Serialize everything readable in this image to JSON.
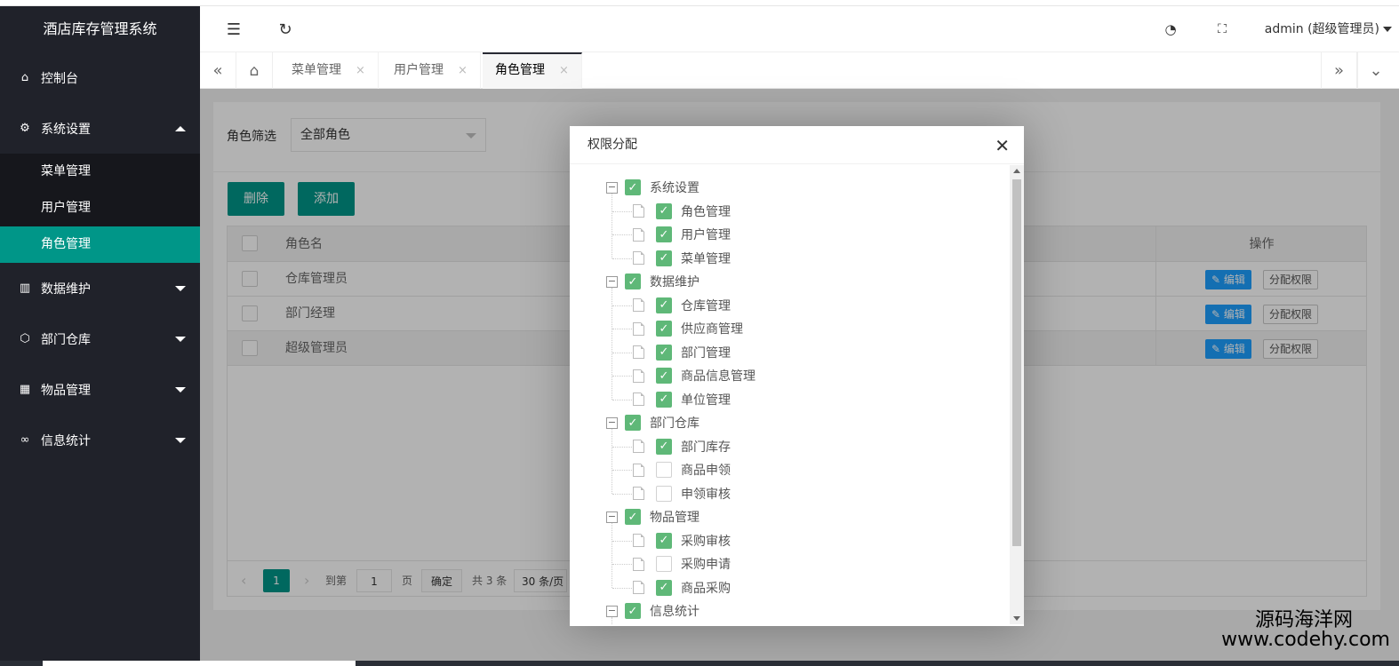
{
  "app": {
    "title": "酒店库存管理系统"
  },
  "sidebar": {
    "items": [
      {
        "label": "控制台",
        "icon": "home-icon"
      },
      {
        "label": "系统设置",
        "icon": "gear-icon",
        "expanded": true,
        "children": [
          {
            "label": "菜单管理"
          },
          {
            "label": "用户管理"
          },
          {
            "label": "角色管理",
            "active": true
          }
        ]
      },
      {
        "label": "数据维护",
        "icon": "data-icon"
      },
      {
        "label": "部门仓库",
        "icon": "box-icon"
      },
      {
        "label": "物品管理",
        "icon": "apps-icon"
      },
      {
        "label": "信息统计",
        "icon": "infinity-icon"
      }
    ]
  },
  "header": {
    "user": "admin (超级管理员)"
  },
  "tabs": [
    {
      "label": "菜单管理",
      "closable": true
    },
    {
      "label": "用户管理",
      "closable": true
    },
    {
      "label": "角色管理",
      "closable": true,
      "active": true
    }
  ],
  "filter": {
    "label": "角色筛选",
    "selected": "全部角色"
  },
  "toolbar": {
    "delete_label": "删除",
    "add_label": "添加"
  },
  "table": {
    "columns": {
      "name": "角色名",
      "ops": "操作"
    },
    "rows": [
      {
        "name": "仓库管理员"
      },
      {
        "name": "部门经理"
      },
      {
        "name": "超级管理员"
      }
    ],
    "edit_label": "编辑",
    "assign_label": "分配权限"
  },
  "pager": {
    "current": "1",
    "goto_label": "到第",
    "page_input": "1",
    "page_unit": "页",
    "confirm": "确定",
    "total": "共 3 条",
    "per_page": "30 条/页"
  },
  "modal": {
    "title": "权限分配",
    "tree": [
      {
        "label": "系统设置",
        "checked": true,
        "children": [
          {
            "label": "角色管理",
            "checked": true
          },
          {
            "label": "用户管理",
            "checked": true
          },
          {
            "label": "菜单管理",
            "checked": true
          }
        ]
      },
      {
        "label": "数据维护",
        "checked": true,
        "children": [
          {
            "label": "仓库管理",
            "checked": true
          },
          {
            "label": "供应商管理",
            "checked": true
          },
          {
            "label": "部门管理",
            "checked": true
          },
          {
            "label": "商品信息管理",
            "checked": true
          },
          {
            "label": "单位管理",
            "checked": true
          }
        ]
      },
      {
        "label": "部门仓库",
        "checked": true,
        "children": [
          {
            "label": "部门库存",
            "checked": true
          },
          {
            "label": "商品申领",
            "checked": false
          },
          {
            "label": "申领审核",
            "checked": false
          }
        ]
      },
      {
        "label": "物品管理",
        "checked": true,
        "children": [
          {
            "label": "采购审核",
            "checked": true
          },
          {
            "label": "采购申请",
            "checked": false
          },
          {
            "label": "商品采购",
            "checked": true
          }
        ]
      },
      {
        "label": "信息统计",
        "checked": true,
        "children": []
      }
    ]
  },
  "watermark": {
    "line1": "源码海洋网",
    "line2": "www.codehy.com"
  },
  "colors": {
    "primary": "#009688",
    "sidebar": "#20222a",
    "check": "#5fb878",
    "edit": "#1e9fff"
  }
}
